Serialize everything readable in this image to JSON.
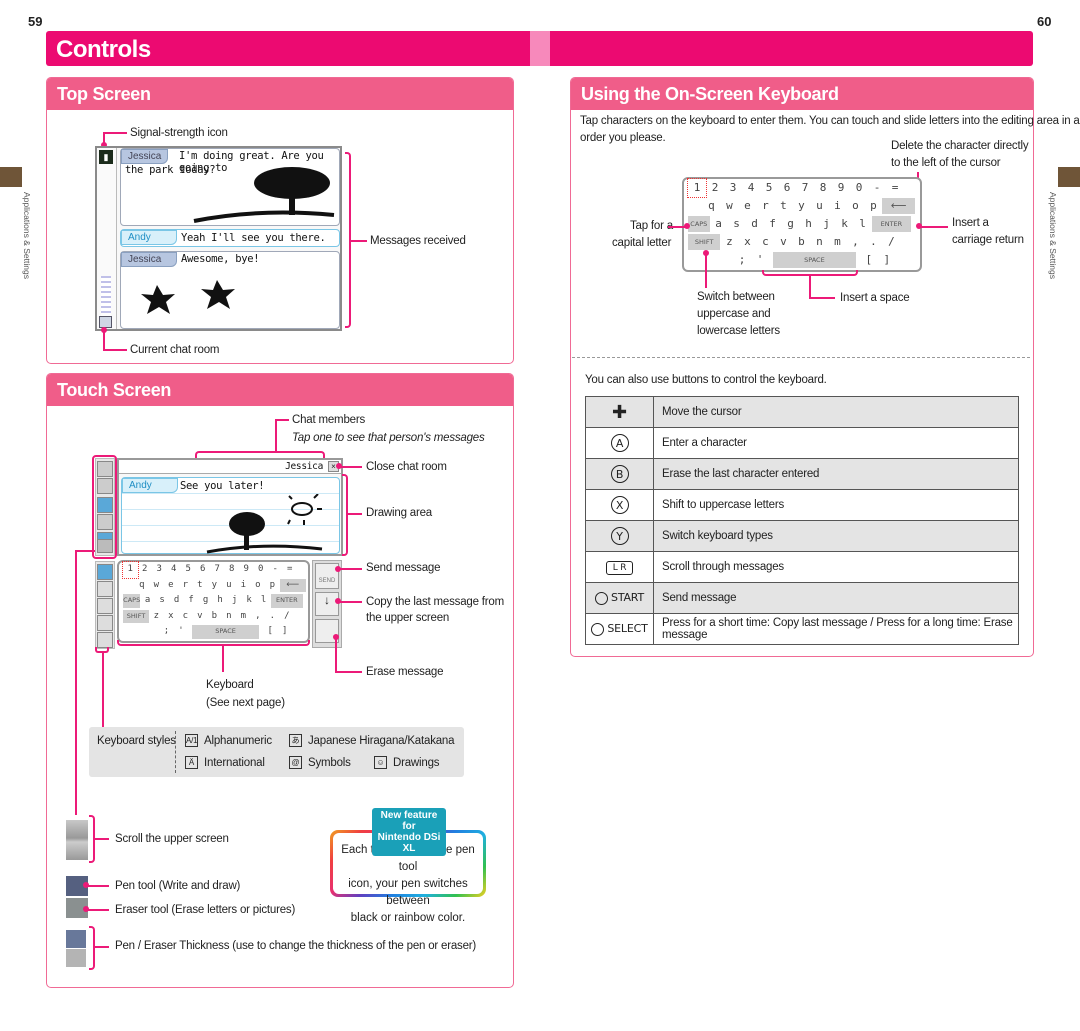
{
  "pages": {
    "left": "59",
    "right": "60"
  },
  "banner": {
    "title": "Controls",
    "color": "#ec0a71"
  },
  "side_tab": {
    "label": "Applications & Settings"
  },
  "top_screen": {
    "title": "Top Screen",
    "labels": {
      "signal": "Signal-strength icon",
      "messages": "Messages received",
      "chat_room": "Current chat room"
    },
    "messages": [
      {
        "name": "Jessica",
        "text": "I'm doing great. Are you going to",
        "text2": "the park today?"
      },
      {
        "name": "Andy",
        "text": "Yeah I'll see you there."
      },
      {
        "name": "Jessica",
        "text": "Awesome, bye!"
      }
    ]
  },
  "touch_screen": {
    "title": "Touch Screen",
    "labels": {
      "chat_members": "Chat members",
      "chat_members_hint": "Tap one to see that person's messages",
      "close_room": "Close chat room",
      "drawing_area": "Drawing area",
      "send": "Send message",
      "copy": "Copy the last message from",
      "copy2": "the upper screen",
      "erase": "Erase message",
      "keyboard": "Keyboard",
      "keyboard2": "(See next page)"
    },
    "member": "Jessica",
    "message": {
      "name": "Andy",
      "text": "See you later!"
    },
    "send_key": "SEND",
    "keyboard_styles": {
      "label": "Keyboard styles",
      "items": [
        {
          "icon": "alphanumeric-icon",
          "glyph": "A/1",
          "label": "Alphanumeric"
        },
        {
          "icon": "hiragana-icon",
          "glyph": "あ",
          "label": "Japanese Hiragana/Katakana"
        },
        {
          "icon": "international-icon",
          "glyph": "Ä",
          "label": "International"
        },
        {
          "icon": "symbols-icon",
          "glyph": "@",
          "label": "Symbols"
        },
        {
          "icon": "drawings-icon",
          "glyph": "☺",
          "label": "Drawings"
        }
      ]
    },
    "legend": {
      "scroll": "Scroll the upper screen",
      "pen": "Pen tool (Write and draw)",
      "eraser": "Eraser tool (Erase letters or pictures)",
      "thickness": "Pen / Eraser Thickness (use to change the thickness of the pen or eraser)"
    },
    "new_feature": {
      "badge1": "New feature for",
      "badge2": "Nintendo DSi XL",
      "line1": "Each time you tap the pen tool",
      "line2": "icon, your pen switches between",
      "line3": "black or rainbow color."
    }
  },
  "keyboard": {
    "rows": [
      [
        "1",
        "2",
        "3",
        "4",
        "5",
        "6",
        "7",
        "8",
        "9",
        "0",
        "-",
        "="
      ],
      [
        "q",
        "w",
        "e",
        "r",
        "t",
        "y",
        "u",
        "i",
        "o",
        "p"
      ],
      [
        "a",
        "s",
        "d",
        "f",
        "g",
        "h",
        "j",
        "k",
        "l"
      ],
      [
        "z",
        "x",
        "c",
        "v",
        "b",
        "n",
        "m",
        ",",
        ".",
        "/"
      ],
      [
        ";",
        "'"
      ]
    ],
    "caps": "CAPS",
    "shift": "SHIFT",
    "enter": "ENTER",
    "space": "SPACE",
    "brackets": [
      "[",
      "]"
    ],
    "backspace_glyph": "⟵",
    "enter_glyph": "↵"
  },
  "onscreen_kb": {
    "title": "Using the On-Screen Keyboard",
    "intro": "Tap characters on the keyboard to enter them. You can touch and slide letters into the editing area in any",
    "intro2": "order you please.",
    "labels": {
      "delete1": "Delete the character directly",
      "delete2": "to the left of the cursor",
      "caps1": "Tap for a",
      "caps2": "capital letter",
      "return1": "Insert a",
      "return2": "carriage return",
      "shift1": "Switch between",
      "shift2": "uppercase and",
      "shift3": "lowercase letters",
      "space": "Insert a space"
    },
    "buttons_intro": "You can also use buttons to control the keyboard.",
    "buttons": [
      {
        "icon": "dpad-icon",
        "glyph": "✚",
        "desc": "Move the cursor"
      },
      {
        "icon": "a-button-icon",
        "glyph": "A",
        "desc": "Enter a character"
      },
      {
        "icon": "b-button-icon",
        "glyph": "B",
        "desc": "Erase the last character entered"
      },
      {
        "icon": "x-button-icon",
        "glyph": "X",
        "desc": "Shift to uppercase letters"
      },
      {
        "icon": "y-button-icon",
        "glyph": "Y",
        "desc": "Switch keyboard types"
      },
      {
        "icon": "l-r-buttons-icon",
        "glyph": "L R",
        "desc": "Scroll through messages"
      },
      {
        "icon": "start-button-icon",
        "glyph": "START",
        "desc": "Send message"
      },
      {
        "icon": "select-button-icon",
        "glyph": "SELECT",
        "desc": "Press for a short time: Copy last message / Press for a long time: Erase message"
      }
    ]
  }
}
